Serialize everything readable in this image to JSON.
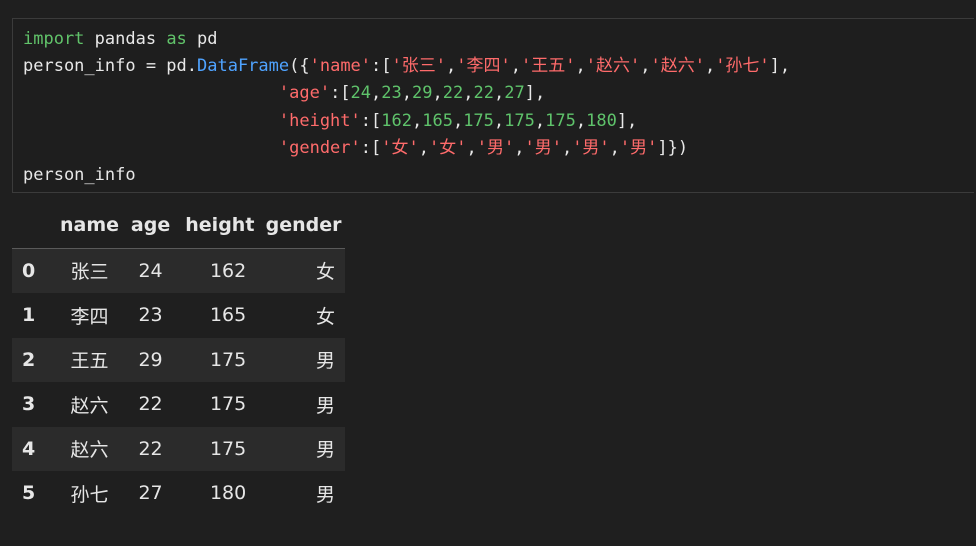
{
  "code": {
    "lines": [
      [
        {
          "t": "import",
          "c": "kw-green"
        },
        {
          "t": " pandas ",
          "c": "plain"
        },
        {
          "t": "as",
          "c": "kw-green"
        },
        {
          "t": " pd",
          "c": "plain"
        }
      ],
      [
        {
          "t": "person_info = pd.",
          "c": "plain"
        },
        {
          "t": "DataFrame",
          "c": "fn"
        },
        {
          "t": "({",
          "c": "plain"
        },
        {
          "t": "'name'",
          "c": "str"
        },
        {
          "t": ":[",
          "c": "plain"
        },
        {
          "t": "'张三'",
          "c": "str"
        },
        {
          "t": ",",
          "c": "plain"
        },
        {
          "t": "'李四'",
          "c": "str"
        },
        {
          "t": ",",
          "c": "plain"
        },
        {
          "t": "'王五'",
          "c": "str"
        },
        {
          "t": ",",
          "c": "plain"
        },
        {
          "t": "'赵六'",
          "c": "str"
        },
        {
          "t": ",",
          "c": "plain"
        },
        {
          "t": "'赵六'",
          "c": "str"
        },
        {
          "t": ",",
          "c": "plain"
        },
        {
          "t": "'孙七'",
          "c": "str"
        },
        {
          "t": "],",
          "c": "plain"
        }
      ],
      [
        {
          "t": "                         ",
          "c": "plain"
        },
        {
          "t": "'age'",
          "c": "str"
        },
        {
          "t": ":[",
          "c": "plain"
        },
        {
          "t": "24",
          "c": "num"
        },
        {
          "t": ",",
          "c": "plain"
        },
        {
          "t": "23",
          "c": "num"
        },
        {
          "t": ",",
          "c": "plain"
        },
        {
          "t": "29",
          "c": "num"
        },
        {
          "t": ",",
          "c": "plain"
        },
        {
          "t": "22",
          "c": "num"
        },
        {
          "t": ",",
          "c": "plain"
        },
        {
          "t": "22",
          "c": "num"
        },
        {
          "t": ",",
          "c": "plain"
        },
        {
          "t": "27",
          "c": "num"
        },
        {
          "t": "],",
          "c": "plain"
        }
      ],
      [
        {
          "t": "                         ",
          "c": "plain"
        },
        {
          "t": "'height'",
          "c": "str"
        },
        {
          "t": ":[",
          "c": "plain"
        },
        {
          "t": "162",
          "c": "num"
        },
        {
          "t": ",",
          "c": "plain"
        },
        {
          "t": "165",
          "c": "num"
        },
        {
          "t": ",",
          "c": "plain"
        },
        {
          "t": "175",
          "c": "num"
        },
        {
          "t": ",",
          "c": "plain"
        },
        {
          "t": "175",
          "c": "num"
        },
        {
          "t": ",",
          "c": "plain"
        },
        {
          "t": "175",
          "c": "num"
        },
        {
          "t": ",",
          "c": "plain"
        },
        {
          "t": "180",
          "c": "num"
        },
        {
          "t": "],",
          "c": "plain"
        }
      ],
      [
        {
          "t": "                         ",
          "c": "plain"
        },
        {
          "t": "'gender'",
          "c": "str"
        },
        {
          "t": ":[",
          "c": "plain"
        },
        {
          "t": "'女'",
          "c": "str"
        },
        {
          "t": ",",
          "c": "plain"
        },
        {
          "t": "'女'",
          "c": "str"
        },
        {
          "t": ",",
          "c": "plain"
        },
        {
          "t": "'男'",
          "c": "str"
        },
        {
          "t": ",",
          "c": "plain"
        },
        {
          "t": "'男'",
          "c": "str"
        },
        {
          "t": ",",
          "c": "plain"
        },
        {
          "t": "'男'",
          "c": "str"
        },
        {
          "t": ",",
          "c": "plain"
        },
        {
          "t": "'男'",
          "c": "str"
        },
        {
          "t": "]})",
          "c": "plain"
        }
      ],
      [
        {
          "t": "person_info",
          "c": "plain"
        }
      ]
    ]
  },
  "table": {
    "headers": [
      "",
      "name",
      "age",
      "height",
      "gender"
    ],
    "rows": [
      {
        "index": "0",
        "name": "张三",
        "age": "24",
        "height": "162",
        "gender": "女"
      },
      {
        "index": "1",
        "name": "李四",
        "age": "23",
        "height": "165",
        "gender": "女"
      },
      {
        "index": "2",
        "name": "王五",
        "age": "29",
        "height": "175",
        "gender": "男"
      },
      {
        "index": "3",
        "name": "赵六",
        "age": "22",
        "height": "175",
        "gender": "男"
      },
      {
        "index": "4",
        "name": "赵六",
        "age": "22",
        "height": "175",
        "gender": "男"
      },
      {
        "index": "5",
        "name": "孙七",
        "age": "27",
        "height": "180",
        "gender": "男"
      }
    ]
  },
  "colors": {
    "background": "#1f1f1f",
    "keyword": "#61c36a",
    "function": "#4fa3ff",
    "string": "#ff6b6b",
    "number": "#5fc36b",
    "stripe": "#2b2b2b"
  }
}
